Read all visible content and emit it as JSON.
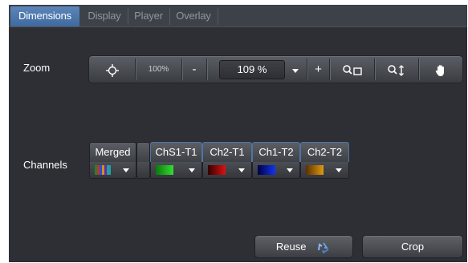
{
  "tabs": [
    {
      "label": "Dimensions",
      "active": true
    },
    {
      "label": "Display",
      "active": false
    },
    {
      "label": "Player",
      "active": false
    },
    {
      "label": "Overlay",
      "active": false
    }
  ],
  "zoom": {
    "label": "Zoom",
    "pct100_label": "100%",
    "minus_label": "-",
    "value": "109 %",
    "plus_label": "+",
    "icons": {
      "center": "crosshair-icon",
      "zoom_region": "zoom-region-icon",
      "zoom_vertical": "zoom-vertical-icon",
      "pan": "hand-icon"
    }
  },
  "channels": {
    "label": "Channels",
    "items": [
      {
        "name": "Merged",
        "color": "merged"
      },
      {
        "name": "ChS1-T1",
        "color": "#22cc22"
      },
      {
        "name": "Ch2-T1",
        "color": "#cc1111"
      },
      {
        "name": "Ch1-T2",
        "color": "#1133ee"
      },
      {
        "name": "Ch2-T2",
        "color": "#e09a10"
      }
    ]
  },
  "buttons": {
    "reuse_label": "Reuse",
    "crop_label": "Crop"
  },
  "colors": {
    "active_tab": "#4f79ad",
    "panel_bg": "#2d2f34",
    "tabbar_bg": "#3d4249"
  }
}
